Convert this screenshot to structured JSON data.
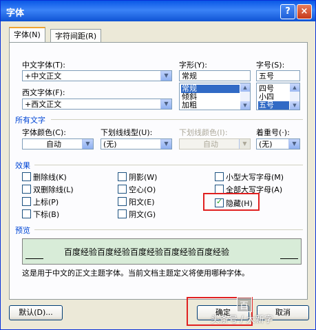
{
  "window": {
    "title": "字体",
    "help_label": "?",
    "close_label": "×"
  },
  "tabs": [
    {
      "label": "字体(N)"
    },
    {
      "label": "字符间距(R)"
    }
  ],
  "fonts": {
    "chinese_font_label": "中文字体(T):",
    "chinese_font_value": "+中文正文",
    "western_font_label": "西文字体(F):",
    "western_font_value": "+西文正文",
    "style_label": "字形(Y):",
    "style_value": "常规",
    "style_options": [
      "常规",
      "倾斜",
      "加粗"
    ],
    "size_label": "字号(S):",
    "size_value": "五号",
    "size_options": [
      "四号",
      "小四",
      "五号"
    ]
  },
  "all_text": {
    "section_label": "所有文字",
    "font_color_label": "字体颜色(C):",
    "font_color_value": "自动",
    "underline_type_label": "下划线线型(U):",
    "underline_type_value": "(无)",
    "underline_color_label": "下划线颜色(I):",
    "underline_color_value": "自动",
    "emphasis_label": "着重号(·):",
    "emphasis_value": "(无)"
  },
  "effects": {
    "section_label": "效果",
    "items": [
      {
        "label": "删除线(K)",
        "checked": false
      },
      {
        "label": "双删除线(L)",
        "checked": false
      },
      {
        "label": "上标(P)",
        "checked": false
      },
      {
        "label": "下标(B)",
        "checked": false
      },
      {
        "label": "阴影(W)",
        "checked": false
      },
      {
        "label": "空心(O)",
        "checked": false
      },
      {
        "label": "阳文(E)",
        "checked": false
      },
      {
        "label": "阴文(G)",
        "checked": false
      },
      {
        "label": "小型大写字母(M)",
        "checked": false
      },
      {
        "label": "全部大写字母(A)",
        "checked": false
      },
      {
        "label": "隐藏(H)",
        "checked": true
      }
    ]
  },
  "preview": {
    "section_label": "预览",
    "sample_text": "百度经验百度经验百度经验百度经验百度经验",
    "description": "这是用于中文的正文主题字体。当前文档主题定义将使用哪种字体。"
  },
  "buttons": {
    "default_label": "默认(D)...",
    "ok_label": "确定",
    "cancel_label": "取消"
  },
  "watermark": {
    "text": "头条号 / 大新字",
    "brand": "百"
  },
  "colors": {
    "highlight": "#e02020",
    "selection": "#316ac5",
    "preview_bg": "#d8ecd8"
  }
}
